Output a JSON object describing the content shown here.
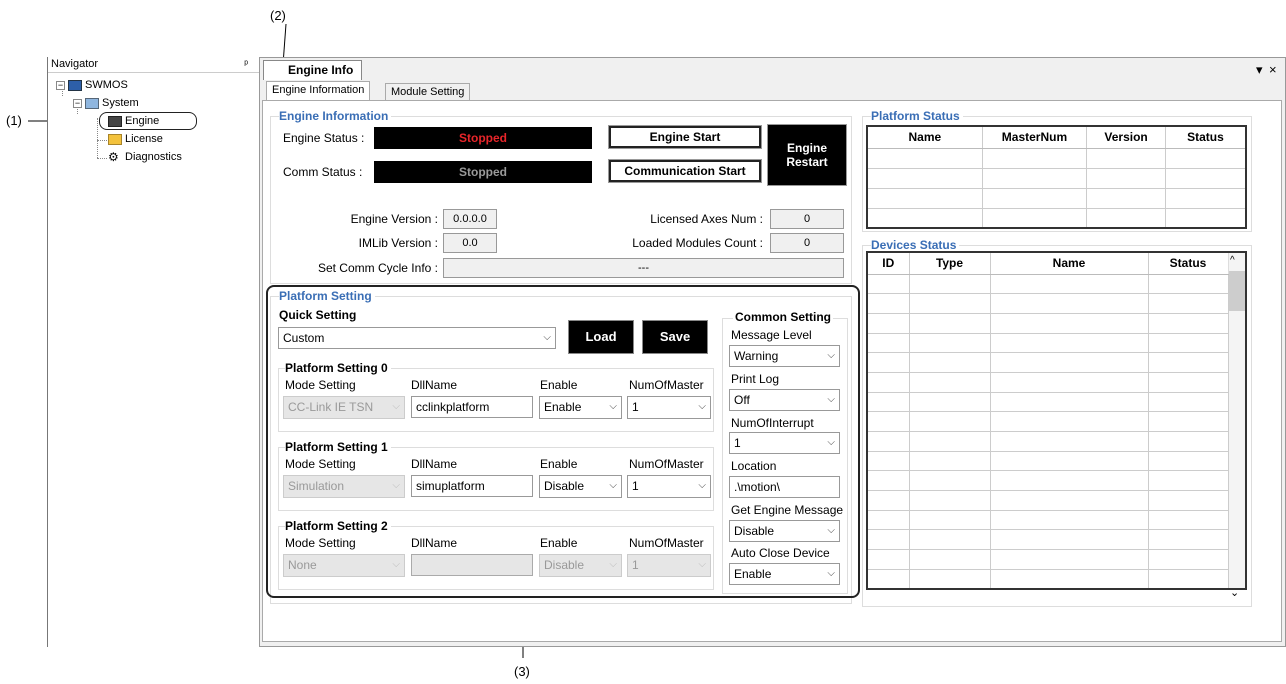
{
  "callouts": {
    "c1": "(1)",
    "c2": "(2)",
    "c3": "(3)"
  },
  "navigator": {
    "title": "Navigator",
    "pin": "ᵖ",
    "tree": {
      "root": "SWMOS",
      "system": "System",
      "engine": "Engine",
      "license": "License",
      "diagnostics": "Diagnostics"
    }
  },
  "document": {
    "tab": "Engine Info",
    "controls": {
      "dropdown": "▾",
      "close": "×"
    }
  },
  "tabs": {
    "engine_information": "Engine Information",
    "module_setting": "Module Setting"
  },
  "engine_information": {
    "group_title": "Engine Information",
    "engine_status_label": "Engine Status :",
    "engine_status_value": "Stopped",
    "comm_status_label": "Comm Status :",
    "comm_status_value": "Stopped",
    "engine_start": "Engine Start",
    "communication_start": "Communication Start",
    "engine_restart_1": "Engine",
    "engine_restart_2": "Restart",
    "engine_version_label": "Engine Version :",
    "engine_version": "0.0.0.0",
    "imlib_version_label": "IMLib Version :",
    "imlib_version": "0.0",
    "licensed_axes_label": "Licensed Axes Num :",
    "licensed_axes": "0",
    "loaded_modules_label": "Loaded Modules Count :",
    "loaded_modules": "0",
    "comm_cycle_label": "Set Comm Cycle Info :",
    "comm_cycle_value": "---"
  },
  "platform_setting": {
    "group_title": "Platform Setting",
    "quick_setting_label": "Quick Setting",
    "quick_setting_value": "Custom",
    "load": "Load",
    "save": "Save",
    "col_mode": "Mode Setting",
    "col_dll": "DllName",
    "col_enable": "Enable",
    "col_num": "NumOfMaster",
    "p0": {
      "title": "Platform Setting 0",
      "mode": "CC-Link IE TSN",
      "dll": "cclinkplatform",
      "enable": "Enable",
      "num": "1"
    },
    "p1": {
      "title": "Platform Setting 1",
      "mode": "Simulation",
      "dll": "simuplatform",
      "enable": "Disable",
      "num": "1"
    },
    "p2": {
      "title": "Platform Setting 2",
      "mode": "None",
      "dll": "",
      "enable": "Disable",
      "num": "1"
    }
  },
  "common_setting": {
    "title": "Common Setting",
    "message_level_label": "Message Level",
    "message_level": "Warning",
    "print_log_label": "Print Log",
    "print_log": "Off",
    "num_interrupt_label": "NumOfInterrupt",
    "num_interrupt": "1",
    "location_label": "Location",
    "location": ".\\motion\\",
    "get_engine_msg_label": "Get Engine Message",
    "get_engine_msg": "Disable",
    "auto_close_label": "Auto Close Device",
    "auto_close": "Enable"
  },
  "platform_status": {
    "title": "Platform Status",
    "cols": [
      "Name",
      "MasterNum",
      "Version",
      "Status"
    ]
  },
  "devices_status": {
    "title": "Devices Status",
    "cols": [
      "ID",
      "Type",
      "Name",
      "Status"
    ]
  },
  "icons": {
    "dropdown_arrow": "⌵",
    "scroll_up": "^",
    "scroll_down": "⌄"
  },
  "colors": {
    "stopped": "#e8252a",
    "stopped_gray": "#9a9a9a",
    "group_title": "#3a6eb5"
  }
}
